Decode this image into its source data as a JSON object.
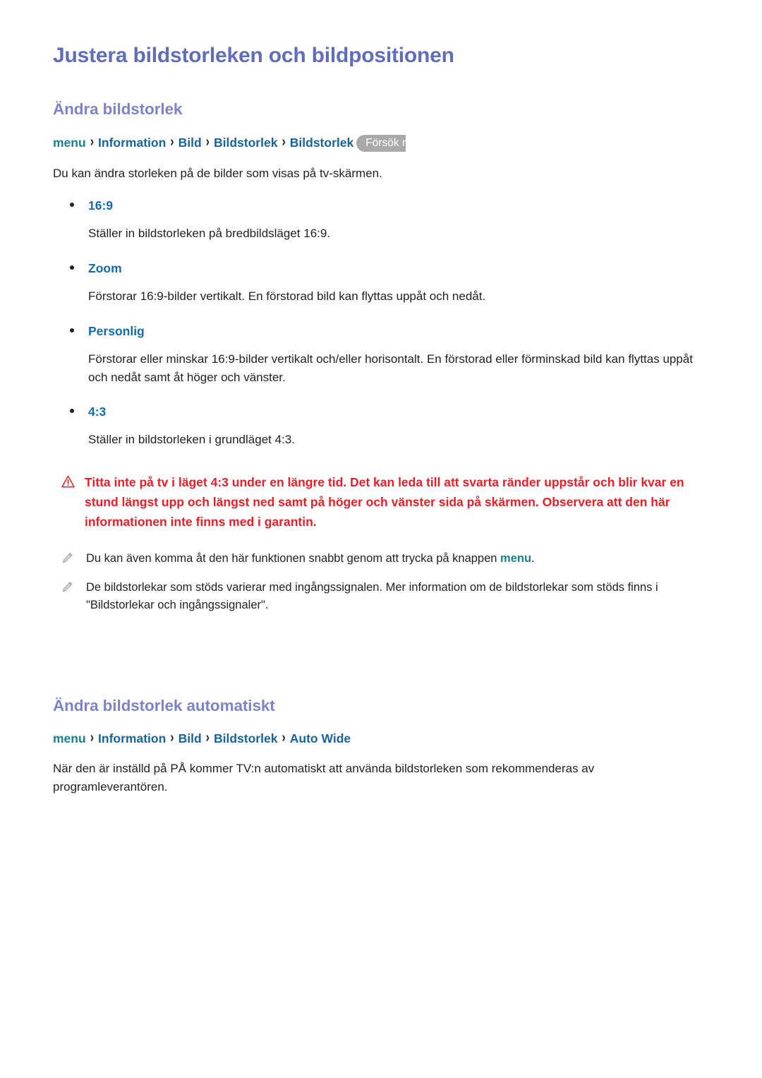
{
  "document": {
    "title": "Justera bildstorleken och bildpositionen"
  },
  "sections": [
    {
      "heading": "Ändra bildstorlek",
      "breadcrumb": {
        "root": "menu",
        "separator": "›",
        "items": [
          "Information",
          "Bild",
          "Bildstorlek",
          "Bildstorlek"
        ],
        "badge": "Försök nu"
      },
      "intro": "Du kan ändra storleken på de bilder som visas på tv-skärmen.",
      "options": [
        {
          "label": "16:9",
          "description": "Ställer in bildstorleken på bredbildsläget 16:9."
        },
        {
          "label": "Zoom",
          "description": "Förstorar 16:9-bilder vertikalt. En förstorad bild kan flyttas uppåt och nedåt."
        },
        {
          "label": "Personlig",
          "description": "Förstorar eller minskar 16:9-bilder vertikalt och/eller horisontalt. En förstorad eller förminskad bild kan flyttas uppåt och nedåt samt åt höger och vänster."
        },
        {
          "label": "4:3",
          "description": "Ställer in bildstorleken i grundläget 4:3."
        }
      ],
      "warning": {
        "icon": "warning-triangle-icon",
        "text": "Titta inte på tv i läget 4:3 under en längre tid. Det kan leda till att svarta ränder uppstår och blir kvar en stund längst upp och längst ned samt på höger och vänster sida på skärmen. Observera att den här informationen inte finns med i garantin."
      },
      "notes": [
        {
          "icon": "pencil-note-icon",
          "text_before": "Du kan även komma åt den här funktionen snabbt genom att trycka på knappen ",
          "inline_emphasis": "menu",
          "text_after": "."
        },
        {
          "icon": "pencil-note-icon",
          "text_before": "De bildstorlekar som stöds varierar med ingångssignalen. Mer information om de bildstorlekar som stöds finns i \"Bildstorlekar och ingångssignaler\".",
          "inline_emphasis": "",
          "text_after": ""
        }
      ]
    },
    {
      "heading": "Ändra bildstorlek automatiskt",
      "breadcrumb": {
        "root": "menu",
        "separator": "›",
        "items": [
          "Information",
          "Bild",
          "Bildstorlek",
          "Auto Wide"
        ],
        "badge": ""
      },
      "intro": "När den är inställd på PÅ kommer TV:n automatiskt att använda bildstorleken som rekommenderas av programleverantören.",
      "options": [],
      "warning": null,
      "notes": []
    }
  ],
  "colors": {
    "title": "#5f6dbd",
    "section_heading": "#7d83c6",
    "crumb_menu": "#12848f",
    "crumb_link": "#15659f",
    "option_label": "#0f6cb0",
    "warning": "#ee1c25",
    "badge_bg": "#a9a9a9",
    "body_text": "#231f20"
  }
}
